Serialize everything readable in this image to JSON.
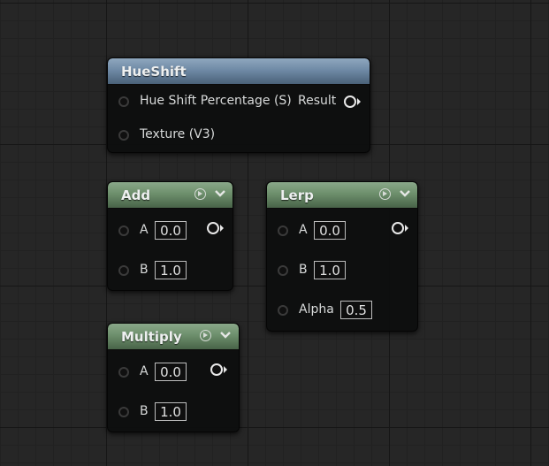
{
  "graph": {
    "nodes": {
      "hueshift": {
        "title": "HueShift",
        "inputs": [
          "Hue Shift Percentage (S)",
          "Texture (V3)"
        ],
        "output": "Result"
      },
      "add": {
        "title": "Add",
        "inputs": [
          {
            "label": "A",
            "value": "0.0"
          },
          {
            "label": "B",
            "value": "1.0"
          }
        ]
      },
      "lerp": {
        "title": "Lerp",
        "inputs": [
          {
            "label": "A",
            "value": "0.0"
          },
          {
            "label": "B",
            "value": "1.0"
          },
          {
            "label": "Alpha",
            "value": "0.5"
          }
        ]
      },
      "multiply": {
        "title": "Multiply",
        "inputs": [
          {
            "label": "A",
            "value": "0.0"
          },
          {
            "label": "B",
            "value": "1.0"
          }
        ]
      }
    }
  },
  "colors": {
    "canvas_background": "#262626",
    "hueshift_header": "#6f8aa6",
    "math_node_header": "#6d8f6c",
    "node_body": "#0e0f0f"
  },
  "icons": {
    "preview_toggle": "play-circle-icon",
    "collapse_toggle": "chevron-down-icon",
    "input_pin": "pin-circle-icon",
    "output_pin": "output-pin-icon"
  }
}
